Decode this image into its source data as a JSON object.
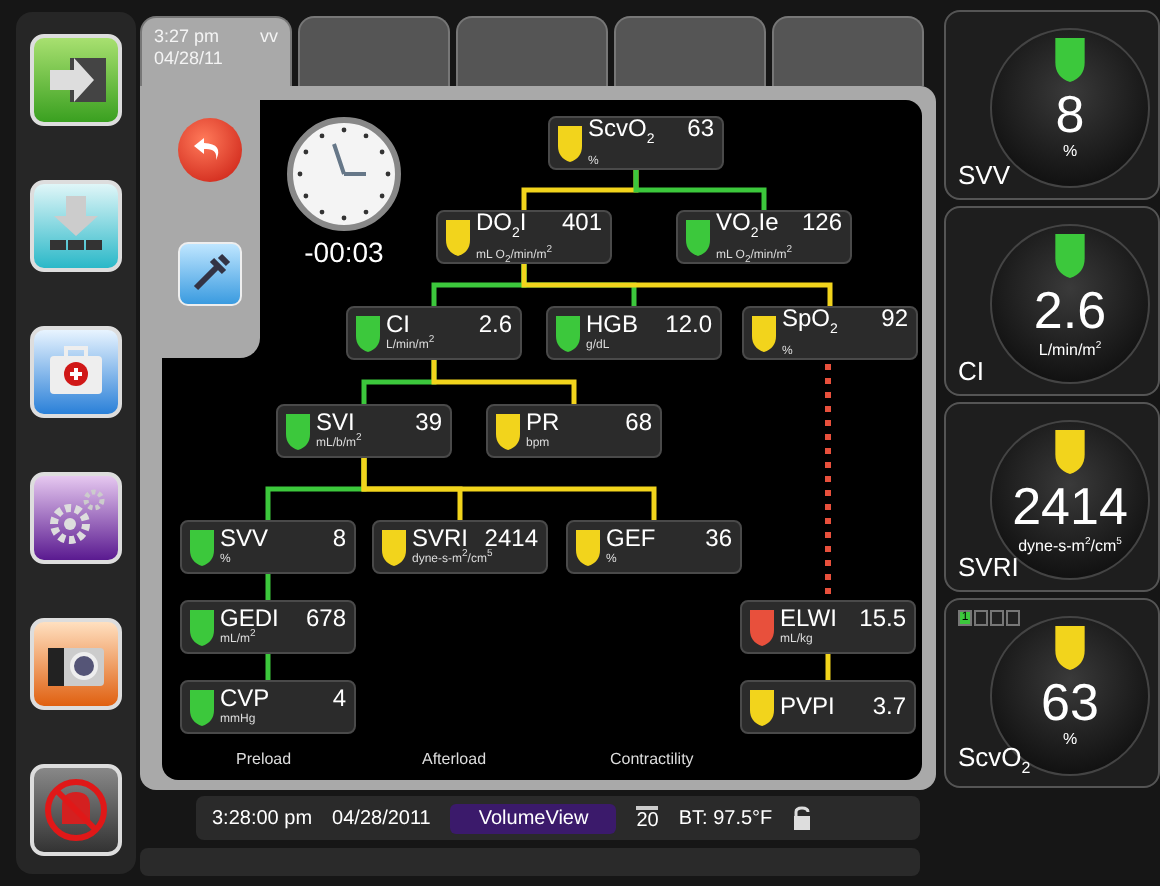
{
  "tabs": [
    {
      "time": "3:27 pm",
      "date": "04/28/11",
      "badge": "vv",
      "selected": true
    },
    {
      "selected": false
    },
    {
      "selected": false
    },
    {
      "selected": false
    },
    {
      "selected": false
    }
  ],
  "timer": "-00:03",
  "tree": {
    "name": "ScvO$_{2}$",
    "value": "63",
    "unit": "%",
    "color": "#f2d41c",
    "children": [
      {
        "name": "DO$_{2}$I",
        "value": "401",
        "unit": "mL O$_{2}$/min/m$^{2}$",
        "color": "#f2d41c",
        "dotted": false,
        "children": [
          {
            "name": "CI",
            "value": "2.6",
            "unit": "L/min/m$^{2}$",
            "color": "#3cc83c",
            "dotted": false,
            "children": [
              {
                "name": "SVI",
                "value": "39",
                "unit": "mL/b/m$^{2}$",
                "color": "#3cc83c",
                "dotted": false,
                "children": [
                  {
                    "name": "SVV",
                    "value": "8",
                    "unit": "%",
                    "color": "#3cc83c",
                    "dotted": false,
                    "children": [
                      {
                        "name": "GEDI",
                        "value": "678",
                        "unit": "mL/m$^{2}$",
                        "color": "#3cc83c",
                        "dotted": false,
                        "children": [
                          {
                            "name": "CVP",
                            "value": "4",
                            "unit": "mmHg",
                            "color": "#3cc83c",
                            "dotted": false
                          }
                        ]
                      }
                    ]
                  },
                  {
                    "name": "SVRI",
                    "value": "2414",
                    "unit": "dyne-s-m$^{2}$/cm$^{5}$",
                    "color": "#f2d41c",
                    "dotted": false
                  },
                  {
                    "name": "GEF",
                    "value": "36",
                    "unit": "%",
                    "color": "#f2d41c",
                    "dotted": false
                  }
                ]
              },
              {
                "name": "PR",
                "value": "68",
                "unit": "bpm",
                "color": "#f2d41c",
                "dotted": false
              }
            ]
          },
          {
            "name": "HGB",
            "value": "12.0",
            "unit": "g/dL",
            "color": "#3cc83c",
            "dotted": false
          },
          {
            "name": "SpO$_{2}$",
            "value": "92",
            "unit": "%",
            "color": "#f2d41c",
            "dotted": false,
            "children": [
              {
                "name": "ELWI",
                "value": "15.5",
                "unit": "mL/kg",
                "color": "#e8503c",
                "dotted": true,
                "children": [
                  {
                    "name": "PVPI",
                    "value": "3.7",
                    "color": "#f2d41c",
                    "dotted": false
                  }
                ]
              }
            ]
          }
        ]
      },
      {
        "name": "VO$_{2}$Ie",
        "value": "126",
        "unit": "mL O$_{2}$/min/m$^{2}$",
        "color": "#3cc83c",
        "dotted": false
      }
    ]
  },
  "categories": [
    "Preload",
    "Afterload",
    "Contractility"
  ],
  "status_bar": {
    "time": "3:28:00 pm",
    "date": "04/28/2011",
    "mode": "VolumeView",
    "count": "20",
    "temperature": "BT: 97.5°F"
  },
  "tiles": [
    {
      "label": "SVV",
      "value": "8",
      "unit": "%",
      "color": "#3cc83c"
    },
    {
      "label": "CI",
      "value": "2.6",
      "unit": "L/min/m$^{2}$",
      "color": "#3cc83c"
    },
    {
      "label": "SVRI",
      "value": "2414",
      "unit": "dyne-s-m$^{2}$/cm$^{5}$",
      "color": "#f2d41c"
    },
    {
      "label": "ScvO$_{2}$",
      "value": "63",
      "unit": "%",
      "color": "#f2d41c",
      "quality": {
        "label": "1",
        "level": 0.25
      }
    }
  ]
}
